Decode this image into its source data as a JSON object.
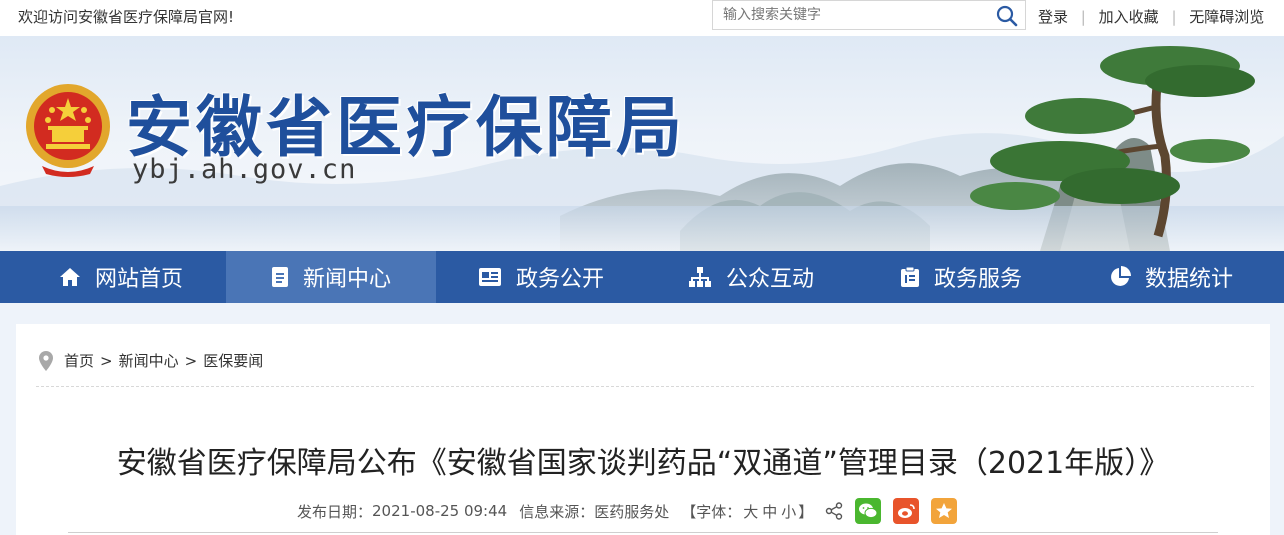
{
  "topbar": {
    "welcome": "欢迎访问安徽省医疗保障局官网!",
    "search_placeholder": "输入搜索关键字",
    "links": [
      "登录",
      "加入收藏",
      "无障碍浏览"
    ]
  },
  "banner": {
    "title": "安徽省医疗保障局",
    "url": "ybj.ah.gov.cn"
  },
  "nav": {
    "items": [
      {
        "label": "网站首页",
        "icon": "home-icon"
      },
      {
        "label": "新闻中心",
        "icon": "document-icon",
        "active": true
      },
      {
        "label": "政务公开",
        "icon": "newspaper-icon"
      },
      {
        "label": "公众互动",
        "icon": "org-chart-icon"
      },
      {
        "label": "政务服务",
        "icon": "clipboard-icon"
      },
      {
        "label": "数据统计",
        "icon": "pie-chart-icon"
      }
    ]
  },
  "breadcrumb": [
    "首页",
    "新闻中心",
    "医保要闻"
  ],
  "article": {
    "title": "安徽省医疗保障局公布《安徽省国家谈判药品“双通道”管理目录（2021年版）》",
    "date_label": "发布日期：",
    "date": "2021-08-25 09:44",
    "source_label": "信息来源：",
    "source": "医药服务处",
    "font_open": "【字体：",
    "font_large": "大",
    "font_medium": "中",
    "font_small": "小",
    "font_close": "】"
  },
  "colors": {
    "nav_bg": "#2b5aa3",
    "nav_active": "#4a75b6",
    "title_blue": "#1f4f9c",
    "wechat": "#4ab72f",
    "weibo": "#e8542b",
    "favorite": "#f2a43b"
  }
}
